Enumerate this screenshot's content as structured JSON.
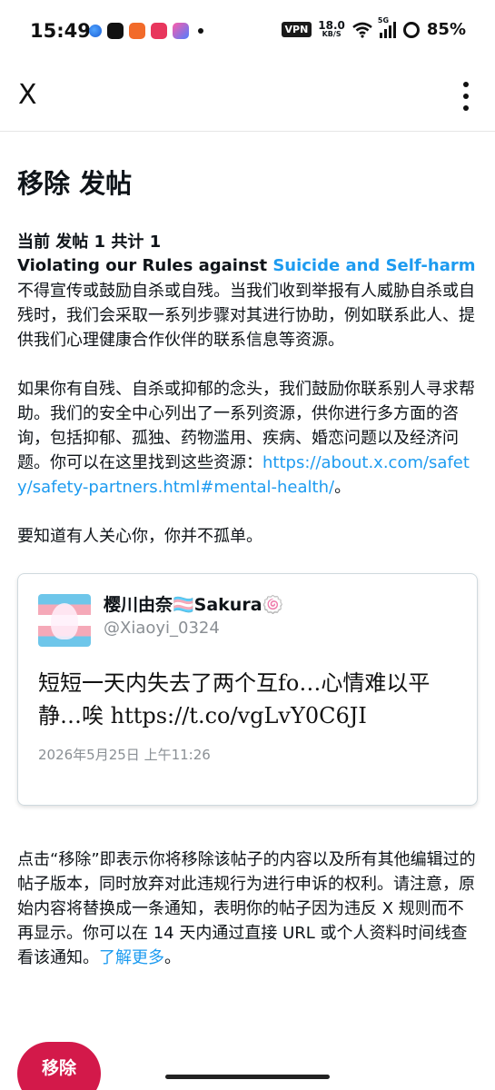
{
  "status_bar": {
    "time": "15:49",
    "vpn": "VPN",
    "speed_value": "18.0",
    "speed_unit": "KB/S",
    "network": "5G",
    "battery": "85%"
  },
  "app_bar": {
    "close_label": "X"
  },
  "page": {
    "title": "移除 发帖",
    "counter": "当前 发帖 1 共计 1",
    "rule_prefix": "Violating our Rules against ",
    "rule_link": "Suicide and Self-harm",
    "para1": "不得宣传或鼓励自杀或自残。当我们收到举报有人威胁自杀或自残时，我们会采取一系列步骤对其进行协助，例如联系此人、提供我们心理健康合作伙伴的联系信息等资源。",
    "para2_text": "如果你有自残、自杀或抑郁的念头，我们鼓励你联系别人寻求帮助。我们的安全中心列出了一系列资源，供你进行多方面的咨询，包括抑郁、孤独、药物滥用、疾病、婚恋问题以及经济问题。你可以在这里找到这些资源：",
    "para2_link": "https://about.x.com/safety/safety-partners.html#mental-health/",
    "para2_end": "。",
    "para3": "要知道有人关心你，你并不孤单。"
  },
  "tweet": {
    "display_name": "樱川由奈🏳️‍⚧️Sakura🍥",
    "handle": "@Xiaoyi_0324",
    "text": "短短一天内失去了两个互fo…心情难以平静…唉 https://t.co/vgLvY0C6JI",
    "date": "2026年5月25日 上午11:26"
  },
  "notice": {
    "text": "点击“移除”即表示你将移除该帖子的内容以及所有其他编辑过的帖子版本，同时放弃对此违规行为进行申诉的权利。请注意，原始内容将替换成一条通知，表明你的帖子因为违反 X 规则而不再显示。你可以在 14 天内通过直接 URL 或个人资料时间线查看该通知。",
    "learn_more": "了解更多",
    "end": "。"
  },
  "actions": {
    "remove_label": "移除"
  },
  "colors": {
    "link": "#1d9bf0",
    "danger": "#d3194a"
  }
}
